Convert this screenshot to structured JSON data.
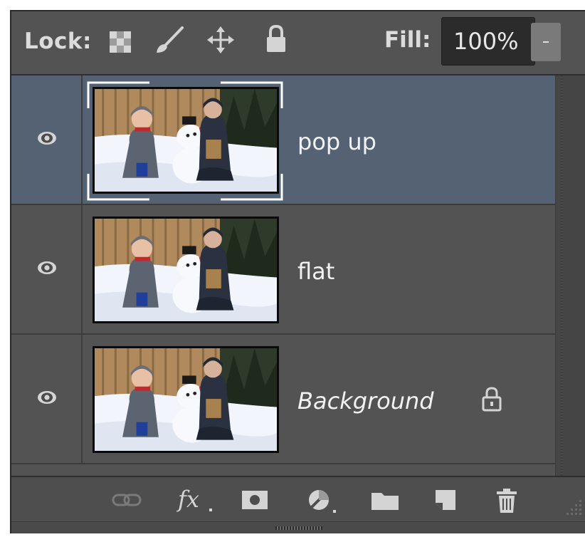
{
  "lock": {
    "label": "Lock:",
    "icons": [
      "checkerboard-lock-icon",
      "brush-lock-icon",
      "move-lock-icon",
      "padlock-icon"
    ]
  },
  "fill": {
    "label": "Fill:",
    "value": "100%"
  },
  "layers": [
    {
      "name": "pop up",
      "selected": true,
      "visible": true,
      "italic": false,
      "locked": false
    },
    {
      "name": "flat",
      "selected": false,
      "visible": true,
      "italic": false,
      "locked": false
    },
    {
      "name": "Background",
      "selected": false,
      "visible": true,
      "italic": true,
      "locked": true
    }
  ],
  "bottom_icons": [
    "link-layers-icon",
    "fx-icon",
    "add-mask-icon",
    "adjustment-layer-icon",
    "new-group-icon",
    "new-layer-icon",
    "delete-icon"
  ],
  "colors": {
    "panel": "#535353",
    "selected_row": "#556274",
    "text": "#f2f2f2"
  }
}
